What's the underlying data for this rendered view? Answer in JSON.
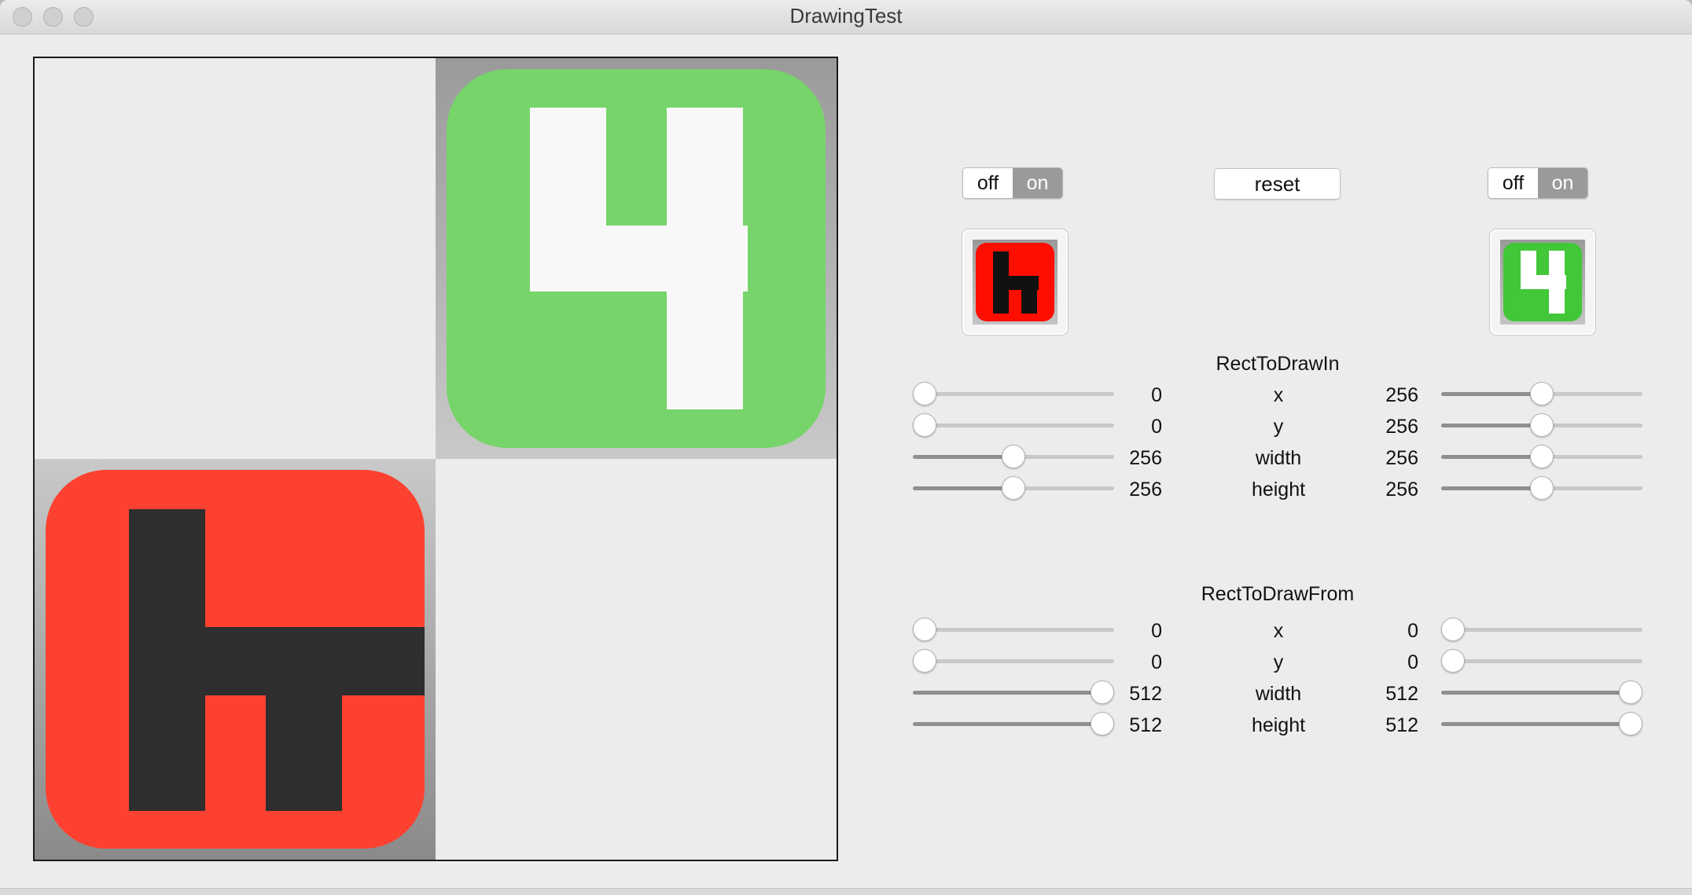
{
  "window": {
    "title": "DrawingTest"
  },
  "canvas": {
    "top_right_glyph": "4",
    "bottom_left_glyph": "h",
    "colors": {
      "green": "#76d46a",
      "red": "#fd4130",
      "white_glyph": "#f8f8f8",
      "dark_glyph": "#2e2e2e"
    }
  },
  "left_toggle": {
    "off": "off",
    "on": "on",
    "selected": "on"
  },
  "right_toggle": {
    "off": "off",
    "on": "on",
    "selected": "on"
  },
  "reset_label": "reset",
  "left_thumb": {
    "glyph": "h",
    "color": "#ff0d00"
  },
  "right_thumb": {
    "glyph": "4",
    "color": "#42c738"
  },
  "sections": {
    "rect_in": {
      "title": "RectToDrawIn",
      "rows": [
        {
          "label": "x",
          "left_value": "0",
          "right_value": "256",
          "left_frac": 0.0,
          "right_frac": 0.5
        },
        {
          "label": "y",
          "left_value": "0",
          "right_value": "256",
          "left_frac": 0.0,
          "right_frac": 0.5
        },
        {
          "label": "width",
          "left_value": "256",
          "right_value": "256",
          "left_frac": 0.5,
          "right_frac": 0.5
        },
        {
          "label": "height",
          "left_value": "256",
          "right_value": "256",
          "left_frac": 0.5,
          "right_frac": 0.5
        }
      ]
    },
    "rect_from": {
      "title": "RectToDrawFrom",
      "rows": [
        {
          "label": "x",
          "left_value": "0",
          "right_value": "0",
          "left_frac": 0.0,
          "right_frac": 0.0
        },
        {
          "label": "y",
          "left_value": "0",
          "right_value": "0",
          "left_frac": 0.0,
          "right_frac": 0.0
        },
        {
          "label": "width",
          "left_value": "512",
          "right_value": "512",
          "left_frac": 1.0,
          "right_frac": 1.0
        },
        {
          "label": "height",
          "left_value": "512",
          "right_value": "512",
          "left_frac": 1.0,
          "right_frac": 1.0
        }
      ]
    }
  }
}
